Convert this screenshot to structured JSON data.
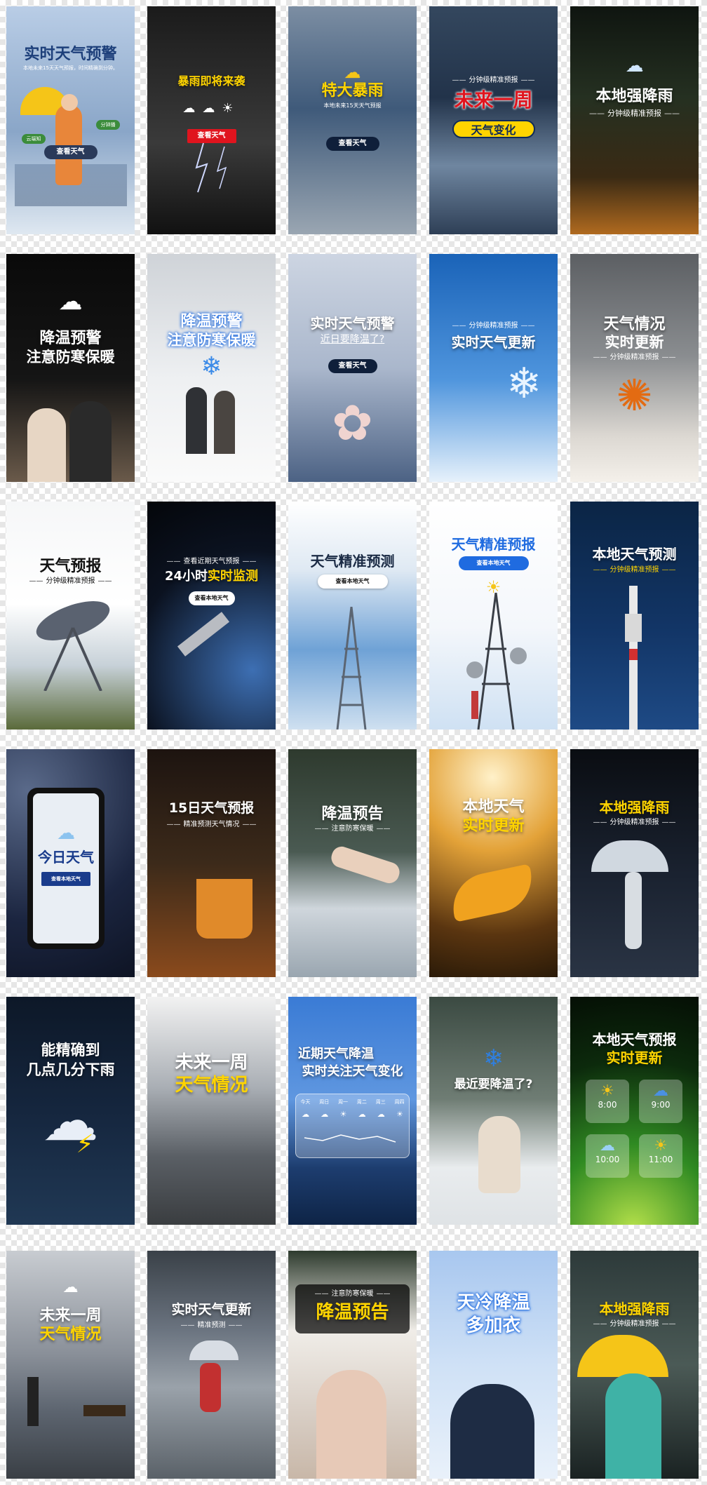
{
  "tiles": [
    {
      "top": "实时天气预警",
      "kicker": "本地未来15天天气预报，时间精确到分钟。",
      "button": "查看天气",
      "tag1": "云端知",
      "tag2": "分钟播"
    },
    {
      "top": "暴雨即将来袭",
      "button": "查看天气"
    },
    {
      "top": "特大暴雨",
      "kicker": "本地未来15天天气预报",
      "button": "查看天气"
    },
    {
      "kicker": "分钟级精准预报",
      "top": "未来一周",
      "bottom": "天气变化"
    },
    {
      "top": "本地强降雨",
      "kicker": "分钟级精准预报"
    },
    {
      "top": "降温预警",
      "bottom": "注意防寒保暖"
    },
    {
      "top": "降温预警",
      "bottom": "注意防寒保暖"
    },
    {
      "top": "实时天气预警",
      "kicker": "近日要降温了?",
      "button": "查看天气"
    },
    {
      "kicker": "分钟级精准预报",
      "top": "实时天气更新"
    },
    {
      "top": "天气情况",
      "bottom": "实时更新",
      "kicker": "分钟级精准预报"
    },
    {
      "top": "天气预报",
      "kicker": "分钟级精准预报"
    },
    {
      "kicker": "查看近期天气预报",
      "top": "24小时",
      "top_em": "实时监测",
      "button": "查看本地天气"
    },
    {
      "top": "天气精准预测",
      "button": "查看本地天气"
    },
    {
      "top": "天气精准预报",
      "button": "查看本地天气"
    },
    {
      "top": "本地天气预测",
      "kicker": "分钟级精准预报"
    },
    {
      "top": "今日天气",
      "button": "查看本地天气"
    },
    {
      "top": "15日天气预报",
      "kicker": "精准预测天气情况"
    },
    {
      "top": "降温预告",
      "kicker": "注意防寒保暖"
    },
    {
      "top": "本地天气",
      "bottom": "实时更新"
    },
    {
      "top": "本地强降雨",
      "kicker": "分钟级精准预报"
    },
    {
      "top": "能精确到",
      "bottom": "几点几分下雨"
    },
    {
      "top": "未来一周",
      "bottom": "天气情况"
    },
    {
      "top": "近期天气降温",
      "bottom": "实时关注天气变化"
    },
    {
      "top": "最近要降温了?"
    },
    {
      "top": "本地天气预报",
      "bottom": "实时更新",
      "times": [
        "8:00",
        "9:00",
        "10:00",
        "11:00"
      ]
    },
    {
      "top": "未来一周",
      "bottom": "天气情况"
    },
    {
      "top": "实时天气更新",
      "kicker": "精准预测"
    },
    {
      "kicker": "注意防寒保暖",
      "top": "降温预告"
    },
    {
      "top": "天冷降温",
      "bottom": "多加衣"
    },
    {
      "top": "本地强降雨",
      "kicker": "分钟级精准预报"
    }
  ],
  "widget_days": [
    "今天",
    "周日",
    "周一",
    "周二",
    "周三",
    "周四"
  ],
  "colors": {
    "yellow": "#ffd400",
    "red": "#e0141e",
    "blue": "#1f6be0",
    "navy": "#0e2a5a"
  }
}
